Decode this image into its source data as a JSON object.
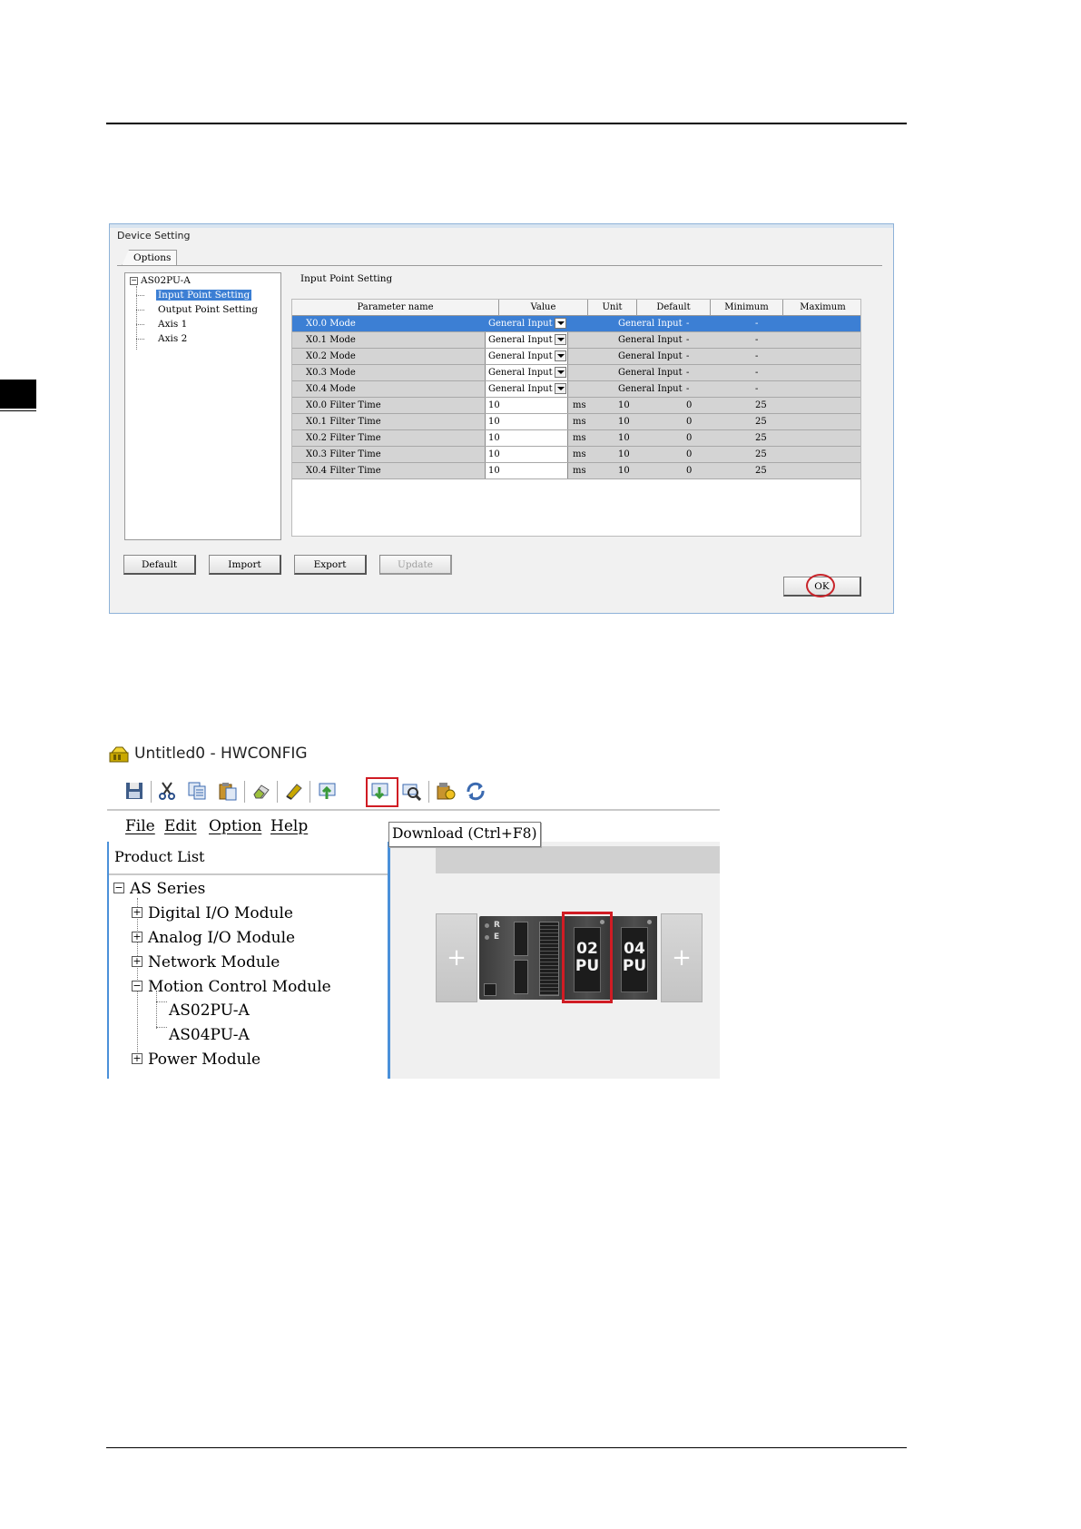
{
  "device_setting": {
    "title": "Device Setting",
    "options_tab": "Options",
    "tree": {
      "root": "AS02PU-A",
      "items": [
        "Input Point Setting",
        "Output Point Setting",
        "Axis 1",
        "Axis 2"
      ],
      "selected": "Input Point Setting"
    },
    "section_title": "Input Point Setting",
    "columns": [
      "Parameter name",
      "Value",
      "Unit",
      "Default",
      "Minimum",
      "Maximum"
    ],
    "rows": [
      {
        "name": "X0.0 Mode",
        "value": "General Input",
        "dropdown": true,
        "unit": "",
        "default": "General Input",
        "min": "-",
        "max": "-"
      },
      {
        "name": "X0.1 Mode",
        "value": "General Input",
        "dropdown": true,
        "unit": "",
        "default": "General Input",
        "min": "-",
        "max": "-"
      },
      {
        "name": "X0.2 Mode",
        "value": "General Input",
        "dropdown": true,
        "unit": "",
        "default": "General Input",
        "min": "-",
        "max": "-"
      },
      {
        "name": "X0.3 Mode",
        "value": "General Input",
        "dropdown": true,
        "unit": "",
        "default": "General Input",
        "min": "-",
        "max": "-"
      },
      {
        "name": "X0.4 Mode",
        "value": "General Input",
        "dropdown": true,
        "unit": "",
        "default": "General Input",
        "min": "-",
        "max": "-"
      },
      {
        "name": "X0.0 Filter Time",
        "value": "10",
        "dropdown": false,
        "unit": "ms",
        "default": "10",
        "min": "0",
        "max": "25"
      },
      {
        "name": "X0.1 Filter Time",
        "value": "10",
        "dropdown": false,
        "unit": "ms",
        "default": "10",
        "min": "0",
        "max": "25"
      },
      {
        "name": "X0.2 Filter Time",
        "value": "10",
        "dropdown": false,
        "unit": "ms",
        "default": "10",
        "min": "0",
        "max": "25"
      },
      {
        "name": "X0.3 Filter Time",
        "value": "10",
        "dropdown": false,
        "unit": "ms",
        "default": "10",
        "min": "0",
        "max": "25"
      },
      {
        "name": "X0.4 Filter Time",
        "value": "10",
        "dropdown": false,
        "unit": "ms",
        "default": "10",
        "min": "0",
        "max": "25"
      }
    ],
    "selected_row": 0,
    "buttons": {
      "default": "Default",
      "import": "Import",
      "export": "Export",
      "update": "Update",
      "ok": "OK"
    },
    "highlight_color": "#c8242a"
  },
  "hwconfig": {
    "title": "Untitled0 - HWCONFIG",
    "toolbar_icons": [
      "save-icon",
      "cut-icon",
      "copy-icon",
      "paste-icon",
      "eraser-icon",
      "online-icon",
      "upload-icon",
      "download-icon",
      "scan-icon",
      "settings-icon",
      "sync-icon"
    ],
    "menu": [
      "File",
      "Edit",
      "Option",
      "Help"
    ],
    "tooltip": "Download (Ctrl+F8)",
    "product_list_label": "Product List",
    "tree": {
      "root": "AS Series",
      "groups": [
        {
          "label": "Digital I/O Module",
          "expanded": false
        },
        {
          "label": "Analog I/O Module",
          "expanded": false
        },
        {
          "label": "Network Module",
          "expanded": false
        },
        {
          "label": "Motion Control Module",
          "expanded": true,
          "children": [
            "AS02PU-A",
            "AS04PU-A"
          ]
        },
        {
          "label": "Power Module",
          "expanded": false
        }
      ]
    },
    "rack": {
      "cpu_labels": [
        "R",
        "E"
      ],
      "modules": [
        {
          "line1": "02",
          "line2": "PU",
          "highlighted": true
        },
        {
          "line1": "04",
          "line2": "PU",
          "highlighted": false
        }
      ],
      "plus": "+"
    },
    "highlight_color": "#d01c24"
  }
}
